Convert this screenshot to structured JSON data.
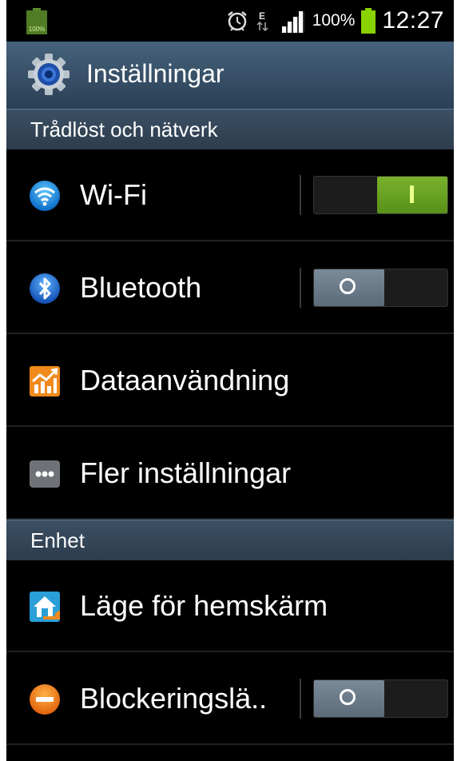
{
  "status_bar": {
    "left_battery_label": "100%",
    "icons": [
      "alarm-icon",
      "edge-data-icon",
      "signal-icon",
      "battery-icon"
    ],
    "battery_percent": "100%",
    "time": "12:27"
  },
  "action_bar": {
    "title": "Inställningar",
    "icon": "settings-gear-icon"
  },
  "sections": [
    {
      "header": "Trådlöst och nätverk",
      "items": [
        {
          "label": "Wi-Fi",
          "icon": "wifi-icon",
          "toggle": "on"
        },
        {
          "label": "Bluetooth",
          "icon": "bluetooth-icon",
          "toggle": "off"
        },
        {
          "label": "Dataanvändning",
          "icon": "data-usage-icon"
        },
        {
          "label": "Fler inställningar",
          "icon": "more-settings-icon"
        }
      ]
    },
    {
      "header": "Enhet",
      "items": [
        {
          "label": "Läge för hemskärm",
          "icon": "home-screen-mode-icon"
        },
        {
          "label": "Blockeringslä..",
          "icon": "blocking-mode-icon",
          "toggle": "off"
        }
      ]
    }
  ],
  "colors": {
    "action_bar": "#3a5269",
    "toggle_on": "#6aa423",
    "toggle_off_knob": "#6c7b89",
    "status_battery": "#8ad100"
  }
}
